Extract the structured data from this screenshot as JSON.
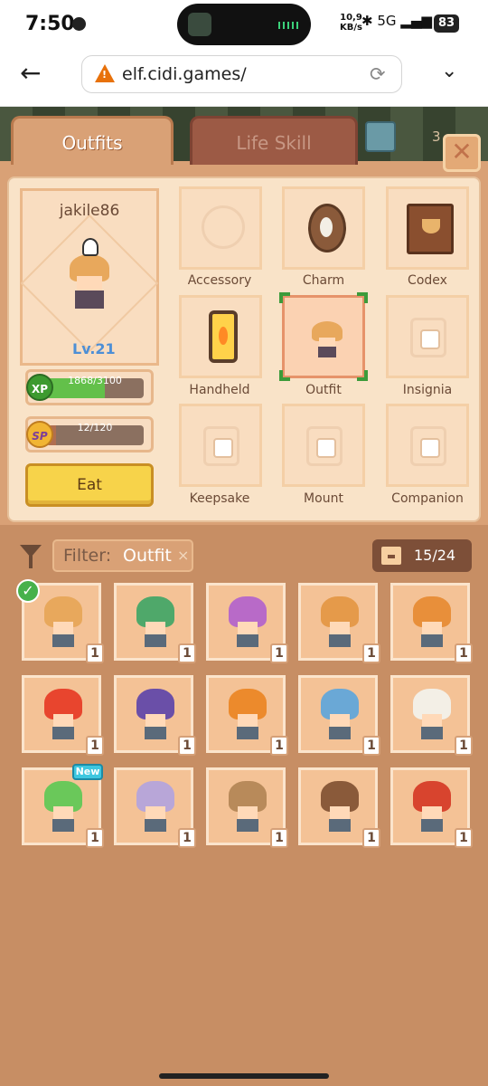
{
  "status": {
    "time": "7:50",
    "speed_top": "10,9",
    "speed_bottom": "KB/s",
    "network": "5G",
    "battery": "83"
  },
  "browser": {
    "url": "elf.cidi.games/"
  },
  "tabs": {
    "outfits": "Outfits",
    "life_skill": "Life Skill",
    "extra_count": "3"
  },
  "profile": {
    "username": "jakile86",
    "level": "Lv.21"
  },
  "xp": {
    "badge": "XP",
    "text": "1868/3100",
    "fraction": 0.603
  },
  "sp": {
    "badge": "SP",
    "text": "12/120",
    "fraction": 0.1
  },
  "eat_label": "Eat",
  "slots": [
    {
      "label": "Accessory"
    },
    {
      "label": "Charm"
    },
    {
      "label": "Codex"
    },
    {
      "label": "Handheld"
    },
    {
      "label": "Outfit"
    },
    {
      "label": "Insignia"
    },
    {
      "label": "Keepsake"
    },
    {
      "label": "Mount"
    },
    {
      "label": "Companion"
    }
  ],
  "filter": {
    "label": "Filter:",
    "value": "Outfit",
    "clear": "×"
  },
  "storage": {
    "text": "15/24"
  },
  "inventory": [
    {
      "count": "1",
      "hat": "#e8a85c"
    },
    {
      "count": "1",
      "hat": "#4fa86a"
    },
    {
      "count": "1",
      "hat": "#b86ac8"
    },
    {
      "count": "1",
      "hat": "#e59a4a"
    },
    {
      "count": "1",
      "hat": "#e88f3a"
    },
    {
      "count": "1",
      "hat": "#e8452e"
    },
    {
      "count": "1",
      "hat": "#6a4fa8"
    },
    {
      "count": "1",
      "hat": "#ec8a2c"
    },
    {
      "count": "1",
      "hat": "#6aa8d6"
    },
    {
      "count": "1",
      "hat": "#f3efe6"
    },
    {
      "count": "1",
      "hat": "#6ac85a"
    },
    {
      "count": "1",
      "hat": "#b8a6d8"
    },
    {
      "count": "1",
      "hat": "#b88a5a"
    },
    {
      "count": "1",
      "hat": "#8a5a3a"
    },
    {
      "count": "1",
      "hat": "#d8442e"
    }
  ],
  "new_badge": "New"
}
